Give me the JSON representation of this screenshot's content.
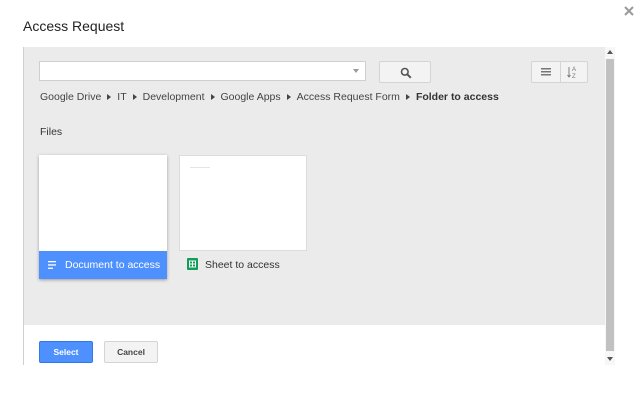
{
  "dialog": {
    "title": "Access Request"
  },
  "search": {
    "value": "",
    "placeholder": ""
  },
  "breadcrumb": {
    "items": [
      "Google Drive",
      "IT",
      "Development",
      "Google Apps",
      "Access Request Form"
    ],
    "current": "Folder to access"
  },
  "files": {
    "section_label": "Files",
    "items": [
      {
        "name": "Document to access",
        "icon": "doc-icon",
        "selected": true
      },
      {
        "name": "Sheet to access",
        "icon": "sheet-icon",
        "selected": false
      }
    ]
  },
  "footer": {
    "select_label": "Select",
    "cancel_label": "Cancel"
  },
  "colors": {
    "accent": "#4d90fe",
    "sheet_icon": "#0f9d58",
    "panel_bg": "#ebebeb"
  },
  "icons": {
    "close": "close-icon",
    "search": "search-icon",
    "list_view": "list-view-icon",
    "sort": "sort-az-icon"
  }
}
